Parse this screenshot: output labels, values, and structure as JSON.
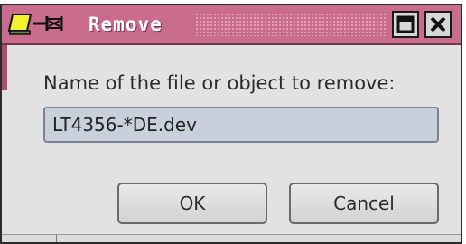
{
  "window": {
    "title": "Remove"
  },
  "dialog": {
    "prompt": "Name of the file or object to remove:",
    "input_value": "LT4356-*DE.dev",
    "ok_label": "OK",
    "cancel_label": "Cancel"
  },
  "icons": {
    "app": "tk-app-icon",
    "maximize": "maximize-icon",
    "close": "close-icon"
  },
  "colors": {
    "titlebar": "#c96c8e",
    "window_bg": "#e2e2e2",
    "input_bg": "#c9cfdb"
  }
}
